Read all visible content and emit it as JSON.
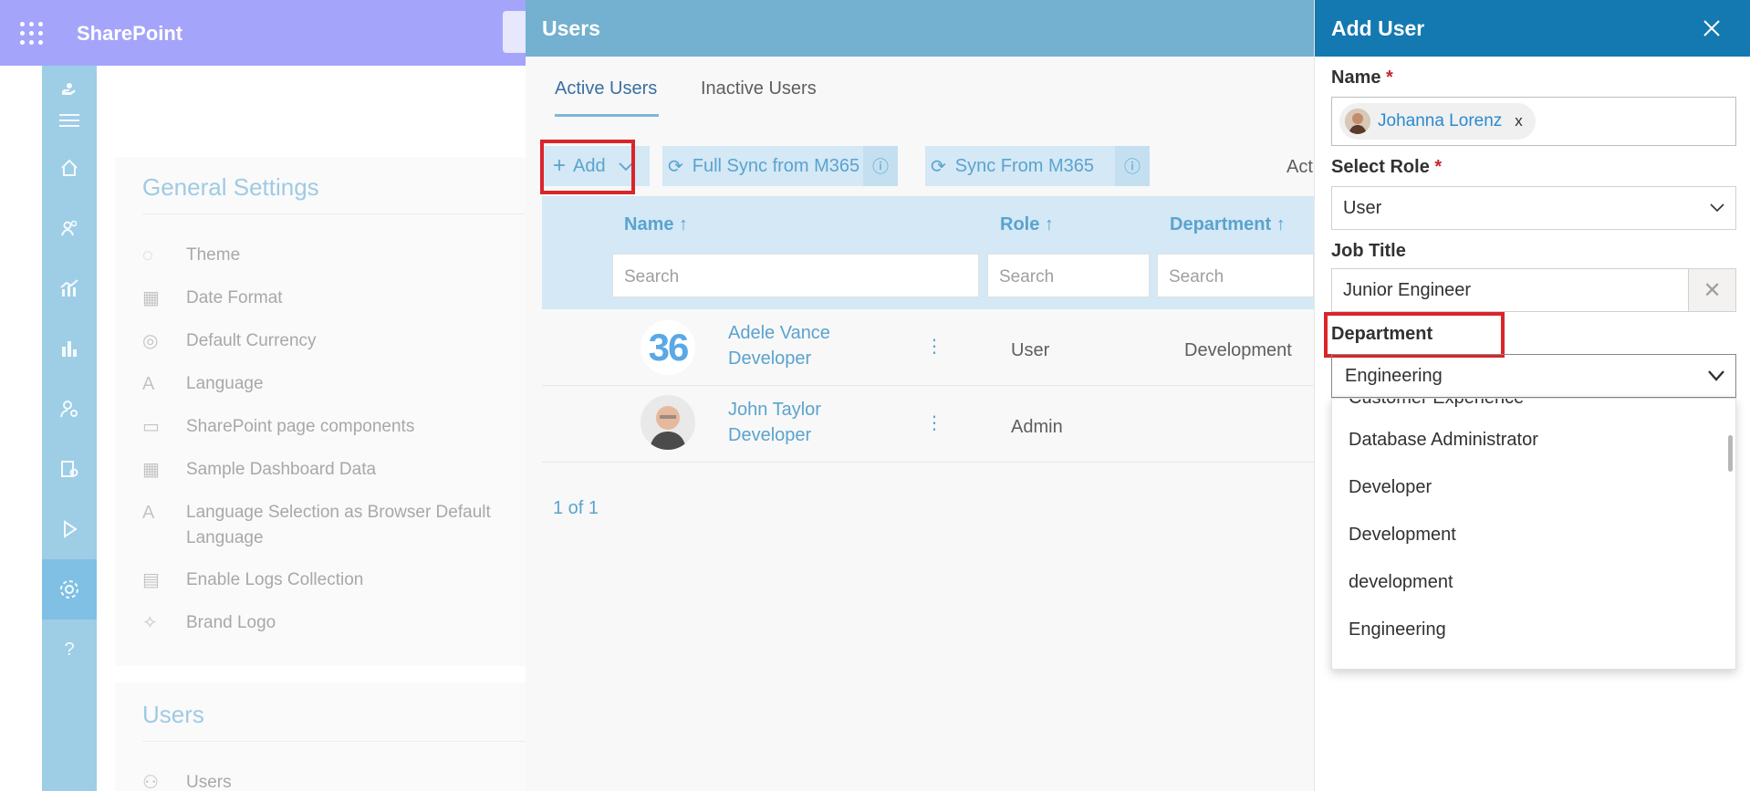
{
  "topbar": {
    "app_name": "SharePoint"
  },
  "settings": {
    "heading": "General Settings",
    "items": [
      {
        "label": "Theme",
        "icon": "palette-icon"
      },
      {
        "label": "Date Format",
        "icon": "calendar-icon"
      },
      {
        "label": "Default Currency",
        "icon": "currency-icon"
      },
      {
        "label": "Language",
        "icon": "language-icon"
      },
      {
        "label": "SharePoint page components",
        "icon": "page-icon"
      },
      {
        "label": "Sample Dashboard Data",
        "icon": "dashboard-icon"
      },
      {
        "label": "Language Selection as Browser Default Language",
        "icon": "language-icon"
      },
      {
        "label": "Enable Logs Collection",
        "icon": "logs-icon"
      },
      {
        "label": "Brand Logo",
        "icon": "badge-icon"
      }
    ],
    "users_heading": "Users",
    "users_item": "Users"
  },
  "users_panel": {
    "title": "Users",
    "tabs": [
      "Active Users",
      "Inactive Users"
    ],
    "toolbar": {
      "add": "Add",
      "full_sync": "Full Sync from M365",
      "sync": "Sync From M365",
      "cut_label": "Act"
    },
    "columns": [
      "Name ↑",
      "Role ↑",
      "Department ↑"
    ],
    "search_placeholder": "Search",
    "rows": [
      {
        "avatar_text": "36",
        "name": "Adele Vance",
        "title": "Developer",
        "role": "User",
        "department": "Development"
      },
      {
        "avatar_text": "",
        "name": "John Taylor",
        "title": "Developer",
        "role": "Admin",
        "department": ""
      }
    ],
    "pager": "1 of 1"
  },
  "add_user": {
    "title": "Add User",
    "name_label": "Name",
    "required_mark": "*",
    "selected_person": "Johanna Lorenz",
    "remove_mark": "x",
    "role_label": "Select Role",
    "role_value": "User",
    "job_title_label": "Job Title",
    "job_title_value": "Junior Engineer",
    "department_label": "Department",
    "department_value": "Engineering",
    "department_options": [
      "Customer Experience",
      "Database Administrator",
      "Developer",
      "Development",
      "development",
      "Engineering"
    ]
  },
  "colors": {
    "highlight": "#d9252a",
    "accent": "#1479b0",
    "topbar": "#a4a4fb"
  }
}
